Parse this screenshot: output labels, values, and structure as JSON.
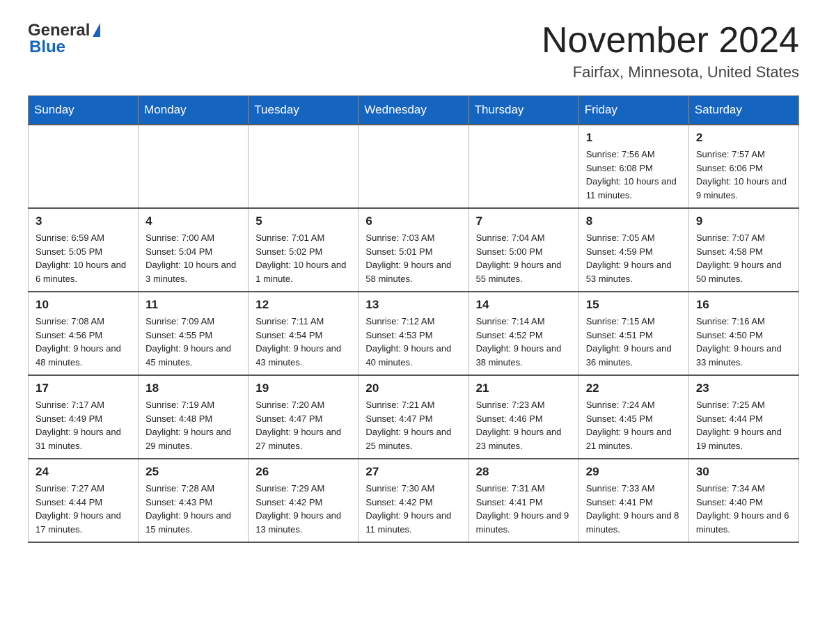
{
  "header": {
    "logo_general": "General",
    "logo_blue": "Blue",
    "month_title": "November 2024",
    "location": "Fairfax, Minnesota, United States"
  },
  "weekdays": [
    "Sunday",
    "Monday",
    "Tuesday",
    "Wednesday",
    "Thursday",
    "Friday",
    "Saturday"
  ],
  "rows": [
    [
      {
        "day": "",
        "info": ""
      },
      {
        "day": "",
        "info": ""
      },
      {
        "day": "",
        "info": ""
      },
      {
        "day": "",
        "info": ""
      },
      {
        "day": "",
        "info": ""
      },
      {
        "day": "1",
        "info": "Sunrise: 7:56 AM\nSunset: 6:08 PM\nDaylight: 10 hours and 11 minutes."
      },
      {
        "day": "2",
        "info": "Sunrise: 7:57 AM\nSunset: 6:06 PM\nDaylight: 10 hours and 9 minutes."
      }
    ],
    [
      {
        "day": "3",
        "info": "Sunrise: 6:59 AM\nSunset: 5:05 PM\nDaylight: 10 hours and 6 minutes."
      },
      {
        "day": "4",
        "info": "Sunrise: 7:00 AM\nSunset: 5:04 PM\nDaylight: 10 hours and 3 minutes."
      },
      {
        "day": "5",
        "info": "Sunrise: 7:01 AM\nSunset: 5:02 PM\nDaylight: 10 hours and 1 minute."
      },
      {
        "day": "6",
        "info": "Sunrise: 7:03 AM\nSunset: 5:01 PM\nDaylight: 9 hours and 58 minutes."
      },
      {
        "day": "7",
        "info": "Sunrise: 7:04 AM\nSunset: 5:00 PM\nDaylight: 9 hours and 55 minutes."
      },
      {
        "day": "8",
        "info": "Sunrise: 7:05 AM\nSunset: 4:59 PM\nDaylight: 9 hours and 53 minutes."
      },
      {
        "day": "9",
        "info": "Sunrise: 7:07 AM\nSunset: 4:58 PM\nDaylight: 9 hours and 50 minutes."
      }
    ],
    [
      {
        "day": "10",
        "info": "Sunrise: 7:08 AM\nSunset: 4:56 PM\nDaylight: 9 hours and 48 minutes."
      },
      {
        "day": "11",
        "info": "Sunrise: 7:09 AM\nSunset: 4:55 PM\nDaylight: 9 hours and 45 minutes."
      },
      {
        "day": "12",
        "info": "Sunrise: 7:11 AM\nSunset: 4:54 PM\nDaylight: 9 hours and 43 minutes."
      },
      {
        "day": "13",
        "info": "Sunrise: 7:12 AM\nSunset: 4:53 PM\nDaylight: 9 hours and 40 minutes."
      },
      {
        "day": "14",
        "info": "Sunrise: 7:14 AM\nSunset: 4:52 PM\nDaylight: 9 hours and 38 minutes."
      },
      {
        "day": "15",
        "info": "Sunrise: 7:15 AM\nSunset: 4:51 PM\nDaylight: 9 hours and 36 minutes."
      },
      {
        "day": "16",
        "info": "Sunrise: 7:16 AM\nSunset: 4:50 PM\nDaylight: 9 hours and 33 minutes."
      }
    ],
    [
      {
        "day": "17",
        "info": "Sunrise: 7:17 AM\nSunset: 4:49 PM\nDaylight: 9 hours and 31 minutes."
      },
      {
        "day": "18",
        "info": "Sunrise: 7:19 AM\nSunset: 4:48 PM\nDaylight: 9 hours and 29 minutes."
      },
      {
        "day": "19",
        "info": "Sunrise: 7:20 AM\nSunset: 4:47 PM\nDaylight: 9 hours and 27 minutes."
      },
      {
        "day": "20",
        "info": "Sunrise: 7:21 AM\nSunset: 4:47 PM\nDaylight: 9 hours and 25 minutes."
      },
      {
        "day": "21",
        "info": "Sunrise: 7:23 AM\nSunset: 4:46 PM\nDaylight: 9 hours and 23 minutes."
      },
      {
        "day": "22",
        "info": "Sunrise: 7:24 AM\nSunset: 4:45 PM\nDaylight: 9 hours and 21 minutes."
      },
      {
        "day": "23",
        "info": "Sunrise: 7:25 AM\nSunset: 4:44 PM\nDaylight: 9 hours and 19 minutes."
      }
    ],
    [
      {
        "day": "24",
        "info": "Sunrise: 7:27 AM\nSunset: 4:44 PM\nDaylight: 9 hours and 17 minutes."
      },
      {
        "day": "25",
        "info": "Sunrise: 7:28 AM\nSunset: 4:43 PM\nDaylight: 9 hours and 15 minutes."
      },
      {
        "day": "26",
        "info": "Sunrise: 7:29 AM\nSunset: 4:42 PM\nDaylight: 9 hours and 13 minutes."
      },
      {
        "day": "27",
        "info": "Sunrise: 7:30 AM\nSunset: 4:42 PM\nDaylight: 9 hours and 11 minutes."
      },
      {
        "day": "28",
        "info": "Sunrise: 7:31 AM\nSunset: 4:41 PM\nDaylight: 9 hours and 9 minutes."
      },
      {
        "day": "29",
        "info": "Sunrise: 7:33 AM\nSunset: 4:41 PM\nDaylight: 9 hours and 8 minutes."
      },
      {
        "day": "30",
        "info": "Sunrise: 7:34 AM\nSunset: 4:40 PM\nDaylight: 9 hours and 6 minutes."
      }
    ]
  ]
}
